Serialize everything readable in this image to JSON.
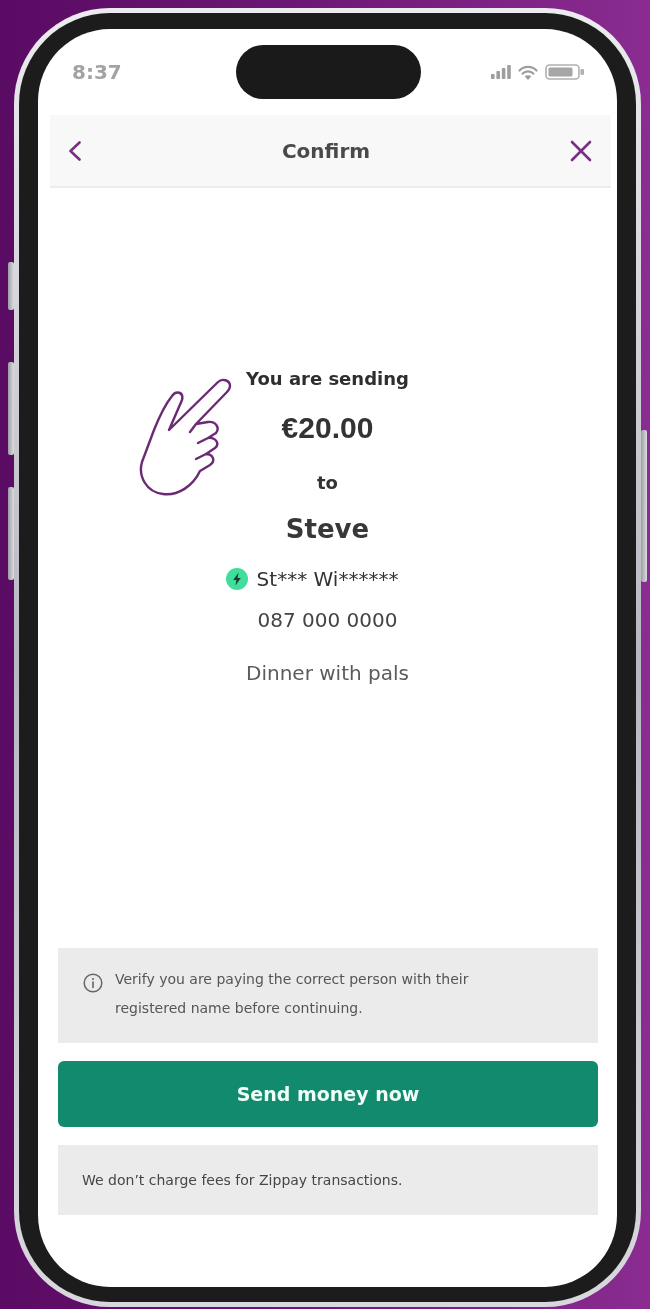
{
  "status_bar": {
    "time": "8:37"
  },
  "header": {
    "title": "Confirm"
  },
  "summary": {
    "intro": "You are sending",
    "amount": "€20.00",
    "connector": "to",
    "recipient": "Steve",
    "masked_name": "St*** Wi******",
    "phone": "087 000 0000",
    "note": "Dinner with pals"
  },
  "notice": {
    "text": "Verify you are paying the correct person with their registered name before continuing."
  },
  "primary_button": {
    "label": "Send money now"
  },
  "fee_note": {
    "text": "We don’t charge fees for Zippay transactions."
  }
}
